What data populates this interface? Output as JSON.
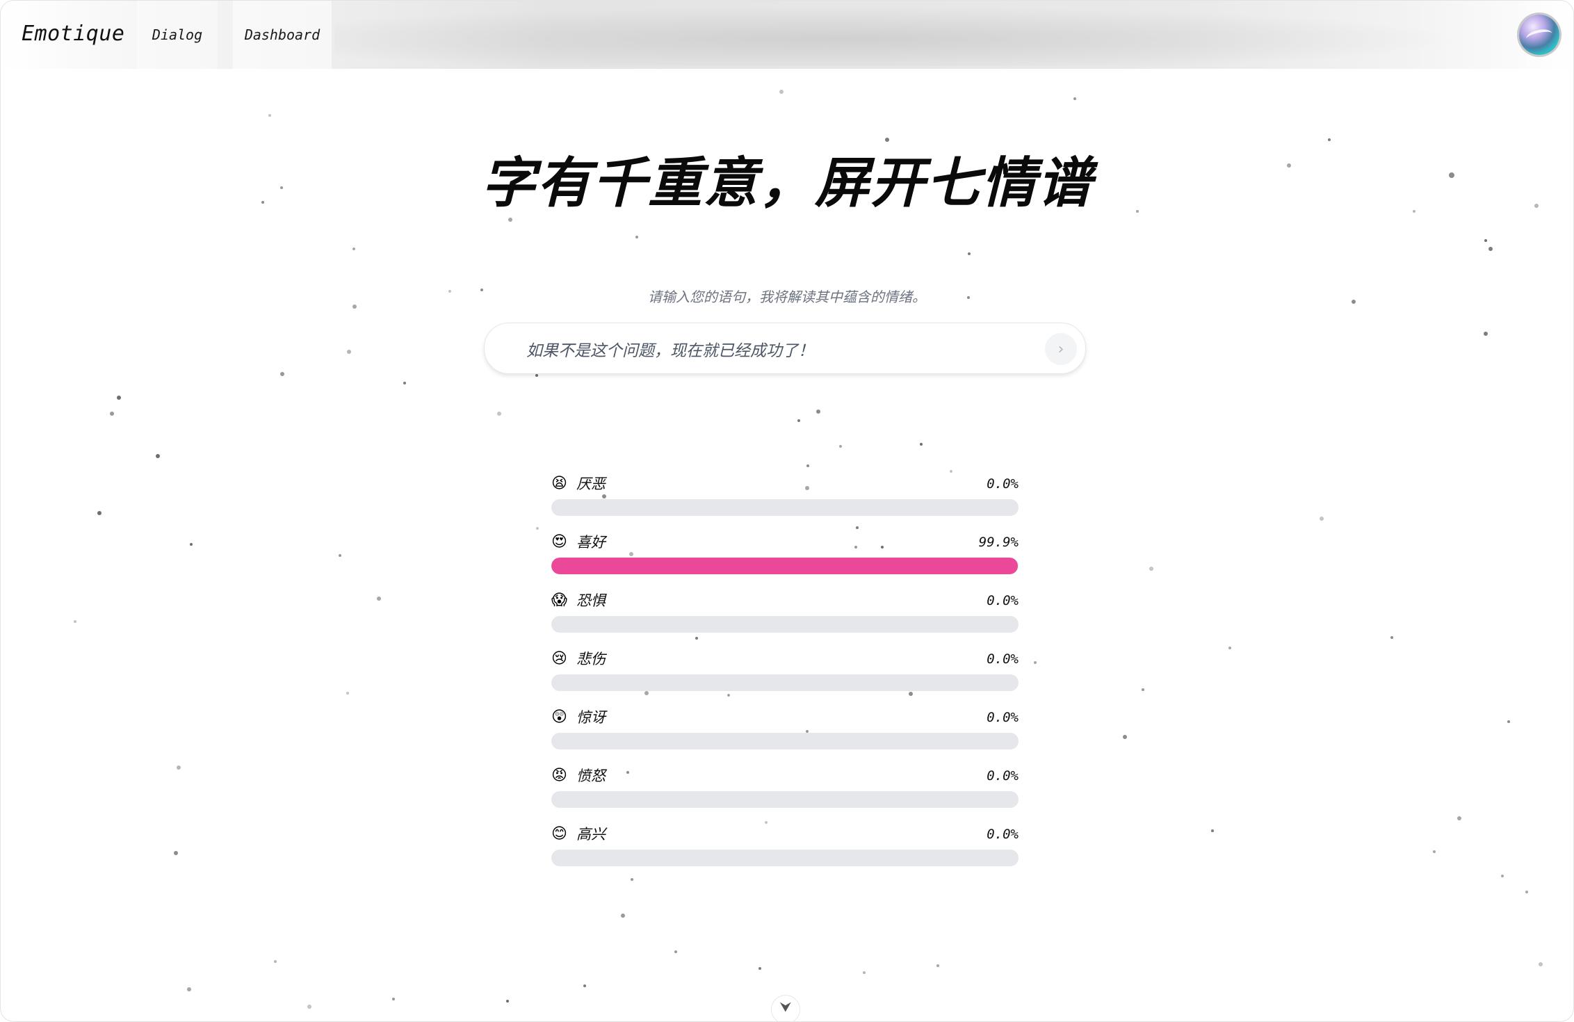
{
  "nav": {
    "brand": "Emotique",
    "items": [
      {
        "label": "Dialog"
      },
      {
        "label": "Dashboard"
      }
    ]
  },
  "hero": {
    "title": "字有千重意，屏开七情谱",
    "subtitle": "请输入您的语句，我将解读其中蕴含的情绪。"
  },
  "input": {
    "value": "如果不是这个问题，现在就已经成功了！",
    "send_icon": "chevron-right-icon"
  },
  "emotions": [
    {
      "icon": "😫",
      "label": "厌恶",
      "value_text": "0.0%",
      "fraction": 0.0
    },
    {
      "icon": "😍",
      "label": "喜好",
      "value_text": "99.9%",
      "fraction": 0.999
    },
    {
      "icon": "😱",
      "label": "恐惧",
      "value_text": "0.0%",
      "fraction": 0.0
    },
    {
      "icon": "😢",
      "label": "悲伤",
      "value_text": "0.0%",
      "fraction": 0.0
    },
    {
      "icon": "😲",
      "label": "惊讶",
      "value_text": "0.0%",
      "fraction": 0.0
    },
    {
      "icon": "😡",
      "label": "愤怒",
      "value_text": "0.0%",
      "fraction": 0.0
    },
    {
      "icon": "😊",
      "label": "高兴",
      "value_text": "0.0%",
      "fraction": 0.0
    }
  ],
  "colors": {
    "bar_fill": "#ec4899",
    "bar_track": "#e5e7eb"
  },
  "scroll_hint_icon": "chevron-down-icon"
}
